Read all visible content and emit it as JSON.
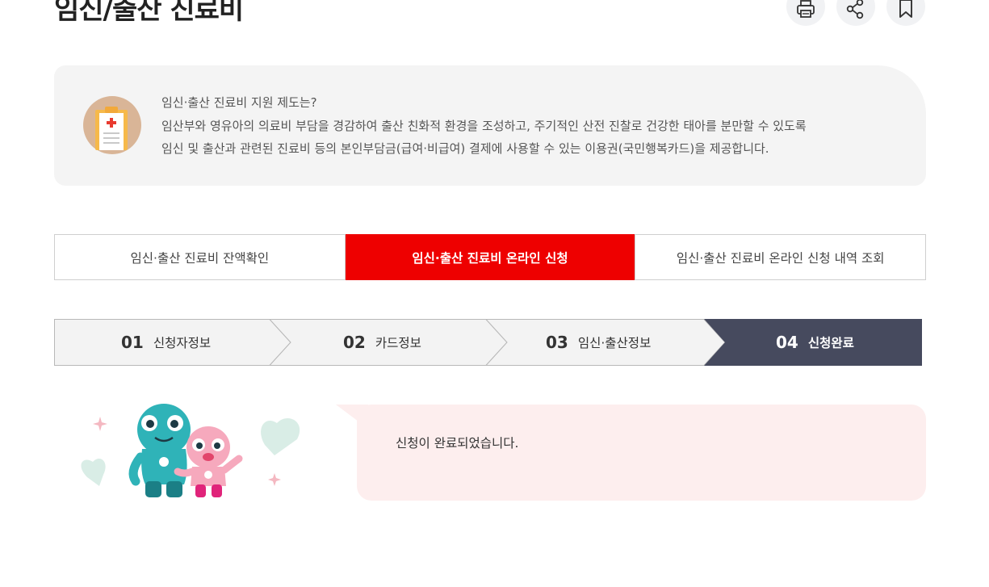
{
  "page": {
    "title": "임신/출산 진료비"
  },
  "toolbar": {
    "icons": [
      "print-icon",
      "share-icon",
      "bookmark-icon"
    ]
  },
  "info": {
    "icon": "medical-record-icon",
    "lines": [
      "임신·출산 진료비 지원 제도는?",
      "임산부와 영유아의 의료비 부담을 경감하여 출산 친화적 환경을 조성하고, 주기적인 산전 진찰로 건강한 태아를 분만할 수 있도록",
      "임신 및 출산과 관련된 진료비 등의 본인부담금(급여·비급여) 결제에 사용할 수 있는 이용권(국민행복카드)을 제공합니다."
    ]
  },
  "tabs": [
    {
      "label": "임신·출산 진료비 잔액확인",
      "active": false
    },
    {
      "label": "임신·출산 진료비 온라인 신청",
      "active": true
    },
    {
      "label": "임신·출산 진료비 온라인 신청 내역 조회",
      "active": false
    }
  ],
  "steps": [
    {
      "num": "01",
      "label": "신청자정보",
      "current": false
    },
    {
      "num": "02",
      "label": "카드정보",
      "current": false
    },
    {
      "num": "03",
      "label": "임신·출산정보",
      "current": false
    },
    {
      "num": "04",
      "label": "신청완료",
      "current": true
    }
  ],
  "result": {
    "message": "신청이 완료되었습니다."
  },
  "colors": {
    "accent": "#ee0000",
    "step_current": "#464a5e",
    "step_bg": "#f3f3f3",
    "message_bg": "#fdeeee",
    "info_bg": "#f4f4f4"
  }
}
